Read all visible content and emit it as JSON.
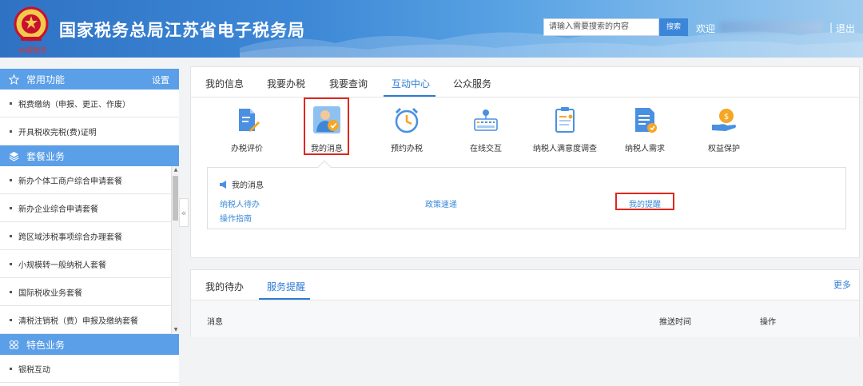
{
  "header": {
    "title": "国家税务总局江苏省电子税务局",
    "logo_caption": "中国税务",
    "search_placeholder": "请输入需要搜索的内容",
    "search_button": "搜索",
    "welcome": "欢迎",
    "separator": "|",
    "logout": "退出"
  },
  "sidebar": {
    "sections": [
      {
        "title": "常用功能",
        "icon": "star-icon",
        "action": "设置",
        "items": [
          "税费缴纳（申报、更正、作废）",
          "开具税收完税(费)证明"
        ]
      },
      {
        "title": "套餐业务",
        "icon": "layers-icon",
        "items": [
          "新办个体工商户综合申请套餐",
          "新办企业综合申请套餐",
          "跨区域涉税事项综合办理套餐",
          "小规模转一般纳税人套餐",
          "国际税收业务套餐",
          "清税注销税（费）申报及缴纳套餐"
        ]
      },
      {
        "title": "特色业务",
        "icon": "grid-icon",
        "items": [
          "银税互动"
        ]
      }
    ],
    "collapse_glyph": "«"
  },
  "main": {
    "tabs": [
      "我的信息",
      "我要办税",
      "我要查询",
      "互动中心",
      "公众服务"
    ],
    "active_tab": "互动中心",
    "icons": [
      {
        "label": "办税评价",
        "icon": "evaluation-icon"
      },
      {
        "label": "我的消息",
        "icon": "message-person-icon"
      },
      {
        "label": "预约办税",
        "icon": "alarm-clock-icon"
      },
      {
        "label": "在线交互",
        "icon": "keyboard-icon"
      },
      {
        "label": "纳税人满意度调查",
        "icon": "survey-clipboard-icon"
      },
      {
        "label": "纳税人需求",
        "icon": "requirement-doc-icon"
      },
      {
        "label": "权益保护",
        "icon": "rights-coin-icon"
      }
    ],
    "submenu": {
      "title": "我的消息",
      "links": [
        "纳税人待办",
        "政策速递",
        "我的提醒",
        "操作指南"
      ]
    }
  },
  "lower": {
    "tabs": [
      "我的待办",
      "服务提醒"
    ],
    "active_tab": "服务提醒",
    "more": "更多",
    "columns": [
      "消息",
      "推送时间",
      "操作"
    ]
  },
  "colors": {
    "accent": "#2d7bd4",
    "sidebar_header": "#5b9fe8",
    "highlight_box": "#e0271e"
  }
}
